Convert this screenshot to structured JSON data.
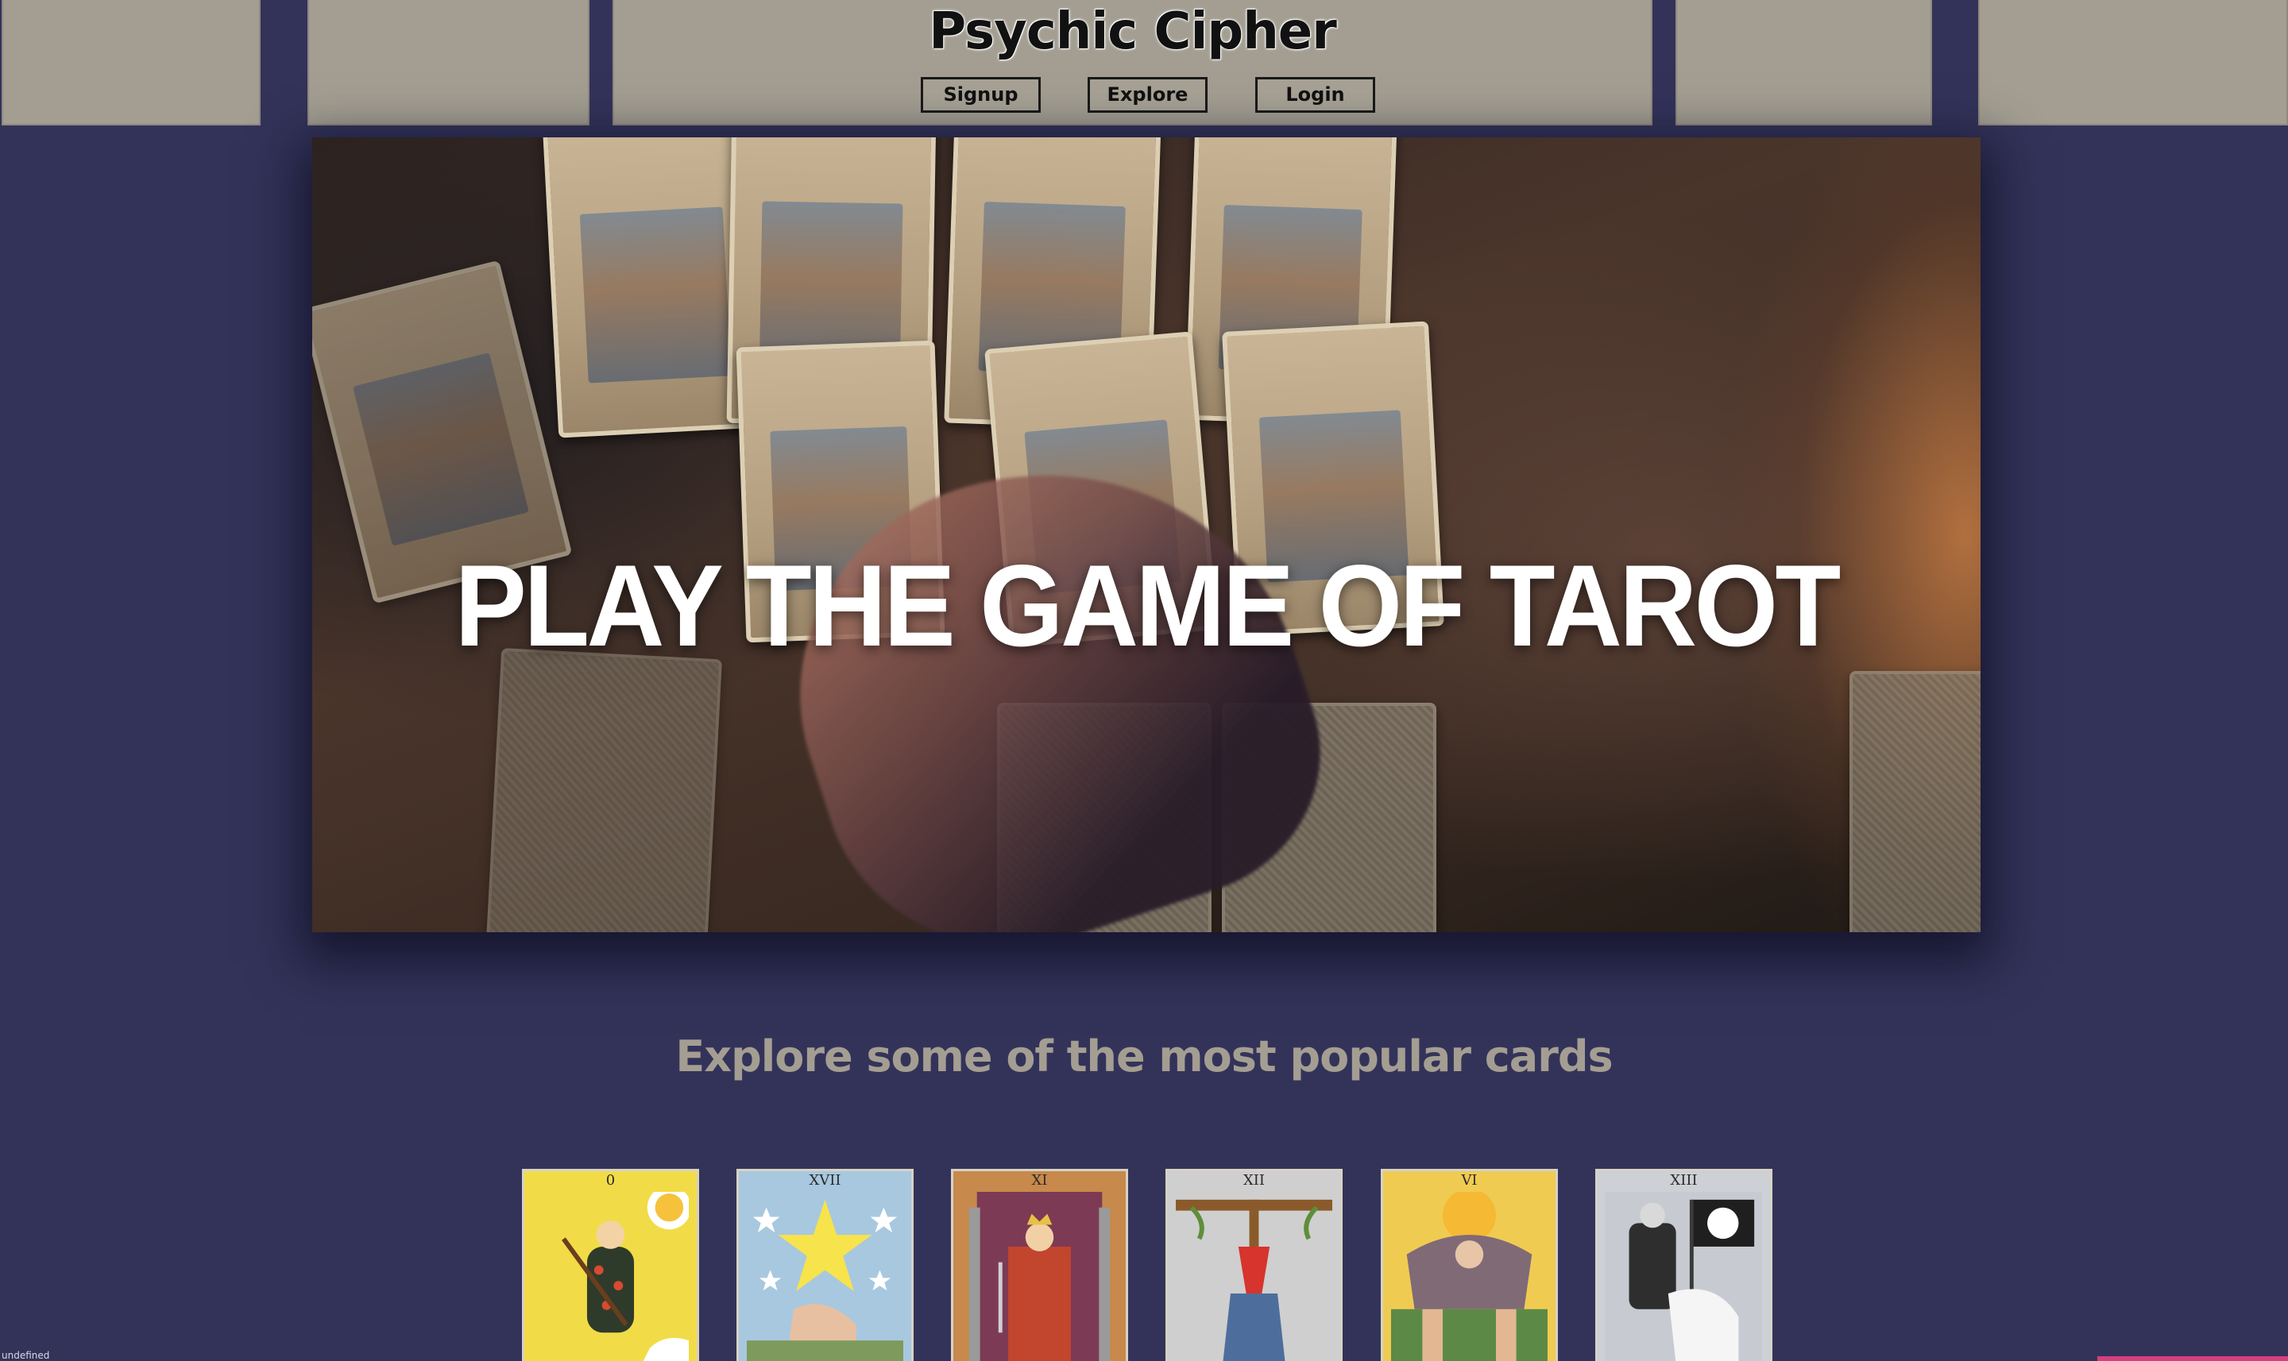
{
  "header": {
    "title": "Psychic Cipher",
    "nav": [
      {
        "label": "Signup"
      },
      {
        "label": "Explore"
      },
      {
        "label": "Login"
      }
    ]
  },
  "hero": {
    "headline": "PLAY THE GAME OF TAROT"
  },
  "explore": {
    "heading": "Explore some of the most popular cards",
    "cards": [
      {
        "numeral": "0",
        "name": "the-fool"
      },
      {
        "numeral": "XVII",
        "name": "the-star"
      },
      {
        "numeral": "XI",
        "name": "justice"
      },
      {
        "numeral": "XII",
        "name": "the-hanged-man"
      },
      {
        "numeral": "VI",
        "name": "the-lovers"
      },
      {
        "numeral": "XIII",
        "name": "death"
      }
    ]
  },
  "status": {
    "text": "undefined"
  },
  "colors": {
    "page_background": "#33335a",
    "header_panel": "#a39e91",
    "heading_text": "#a49e92",
    "accent_bar": "#d63f7d"
  }
}
